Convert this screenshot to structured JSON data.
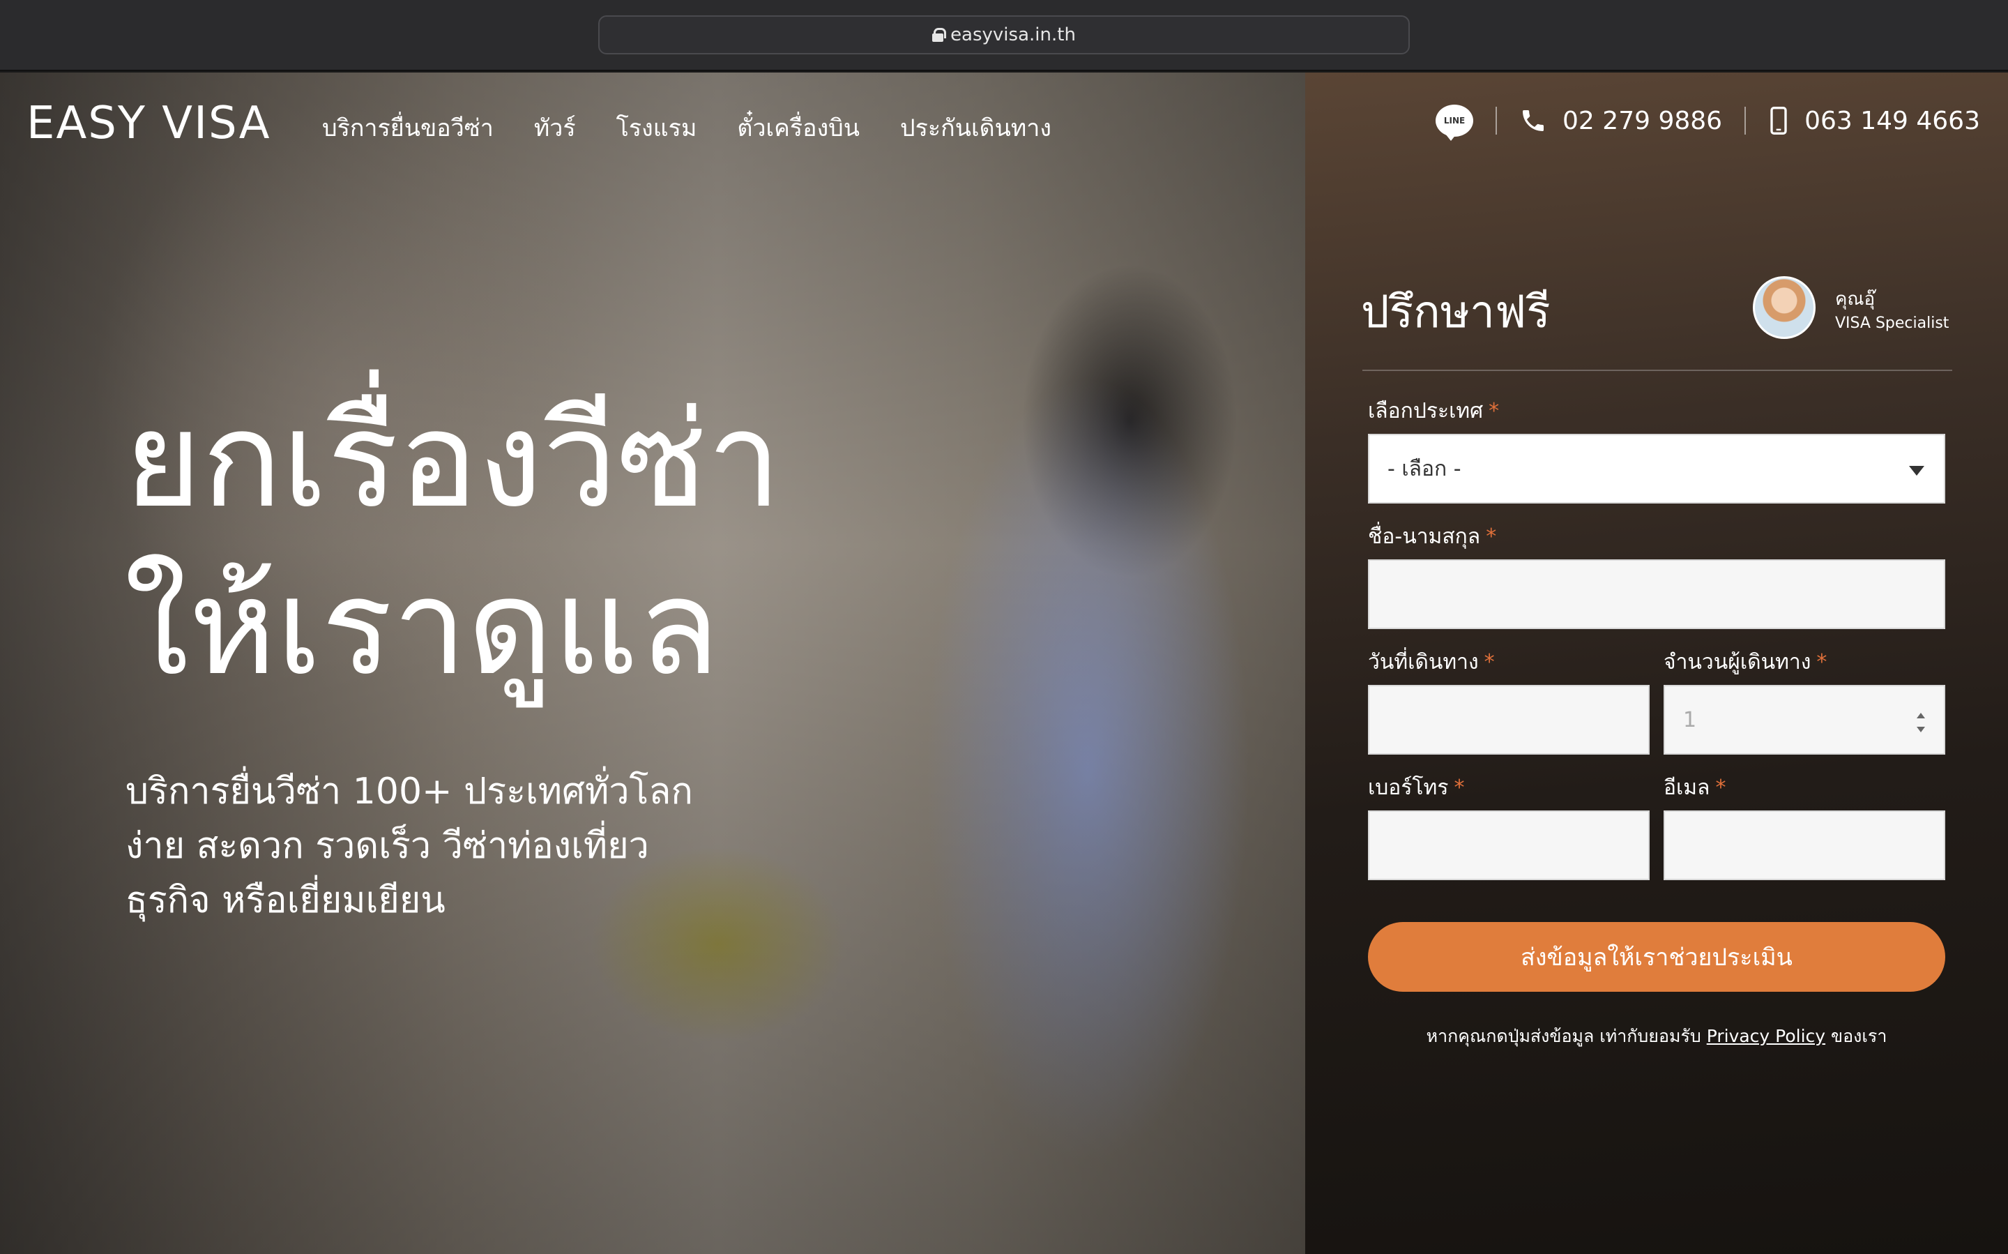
{
  "browser": {
    "url": "easyvisa.in.th"
  },
  "nav": {
    "logo": "EASY VISA",
    "menu": [
      "บริการยื่นขอวีซ่า",
      "ทัวร์",
      "โรงแรม",
      "ตั๋วเครื่องบิน",
      "ประกันเดินทาง"
    ],
    "line_icon_text": "LINE",
    "phone": "02 279 9886",
    "mobile": "063 149 4663"
  },
  "hero": {
    "headline_1": "ยกเรื่องวีซ่า",
    "headline_2": "ให้เราดูแล",
    "sub_1": "บริการยื่นวีซ่า 100+ ประเทศทั่วโลก",
    "sub_2": "ง่าย สะดวก รวดเร็ว วีซ่าท่องเที่ยว",
    "sub_3": "ธุรกิจ หรือเยี่ยมเยียน"
  },
  "form": {
    "title": "ปรึกษาฟรี",
    "specialist_name": "คุณอุ๊",
    "specialist_role": "VISA Specialist",
    "country_label": "เลือกประเทศ",
    "country_value": "- เลือก -",
    "name_label": "ชื่อ-นามสกุล",
    "date_label": "วันที่เดินทาง",
    "travelers_label": "จำนวนผู้เดินทาง",
    "travelers_value": "1",
    "phone_label": "เบอร์โทร",
    "email_label": "อีเมล",
    "required_mark": "*",
    "submit_label": "ส่งข้อมูลให้เราช่วยประเมิน",
    "note_prefix": "หากคุณกดปุ่มส่งข้อมูล เท่ากับยอมรับ",
    "note_link": "Privacy Policy",
    "note_suffix": "ของเรา"
  },
  "colors": {
    "accent": "#e07d3c",
    "required": "#e0703a"
  }
}
